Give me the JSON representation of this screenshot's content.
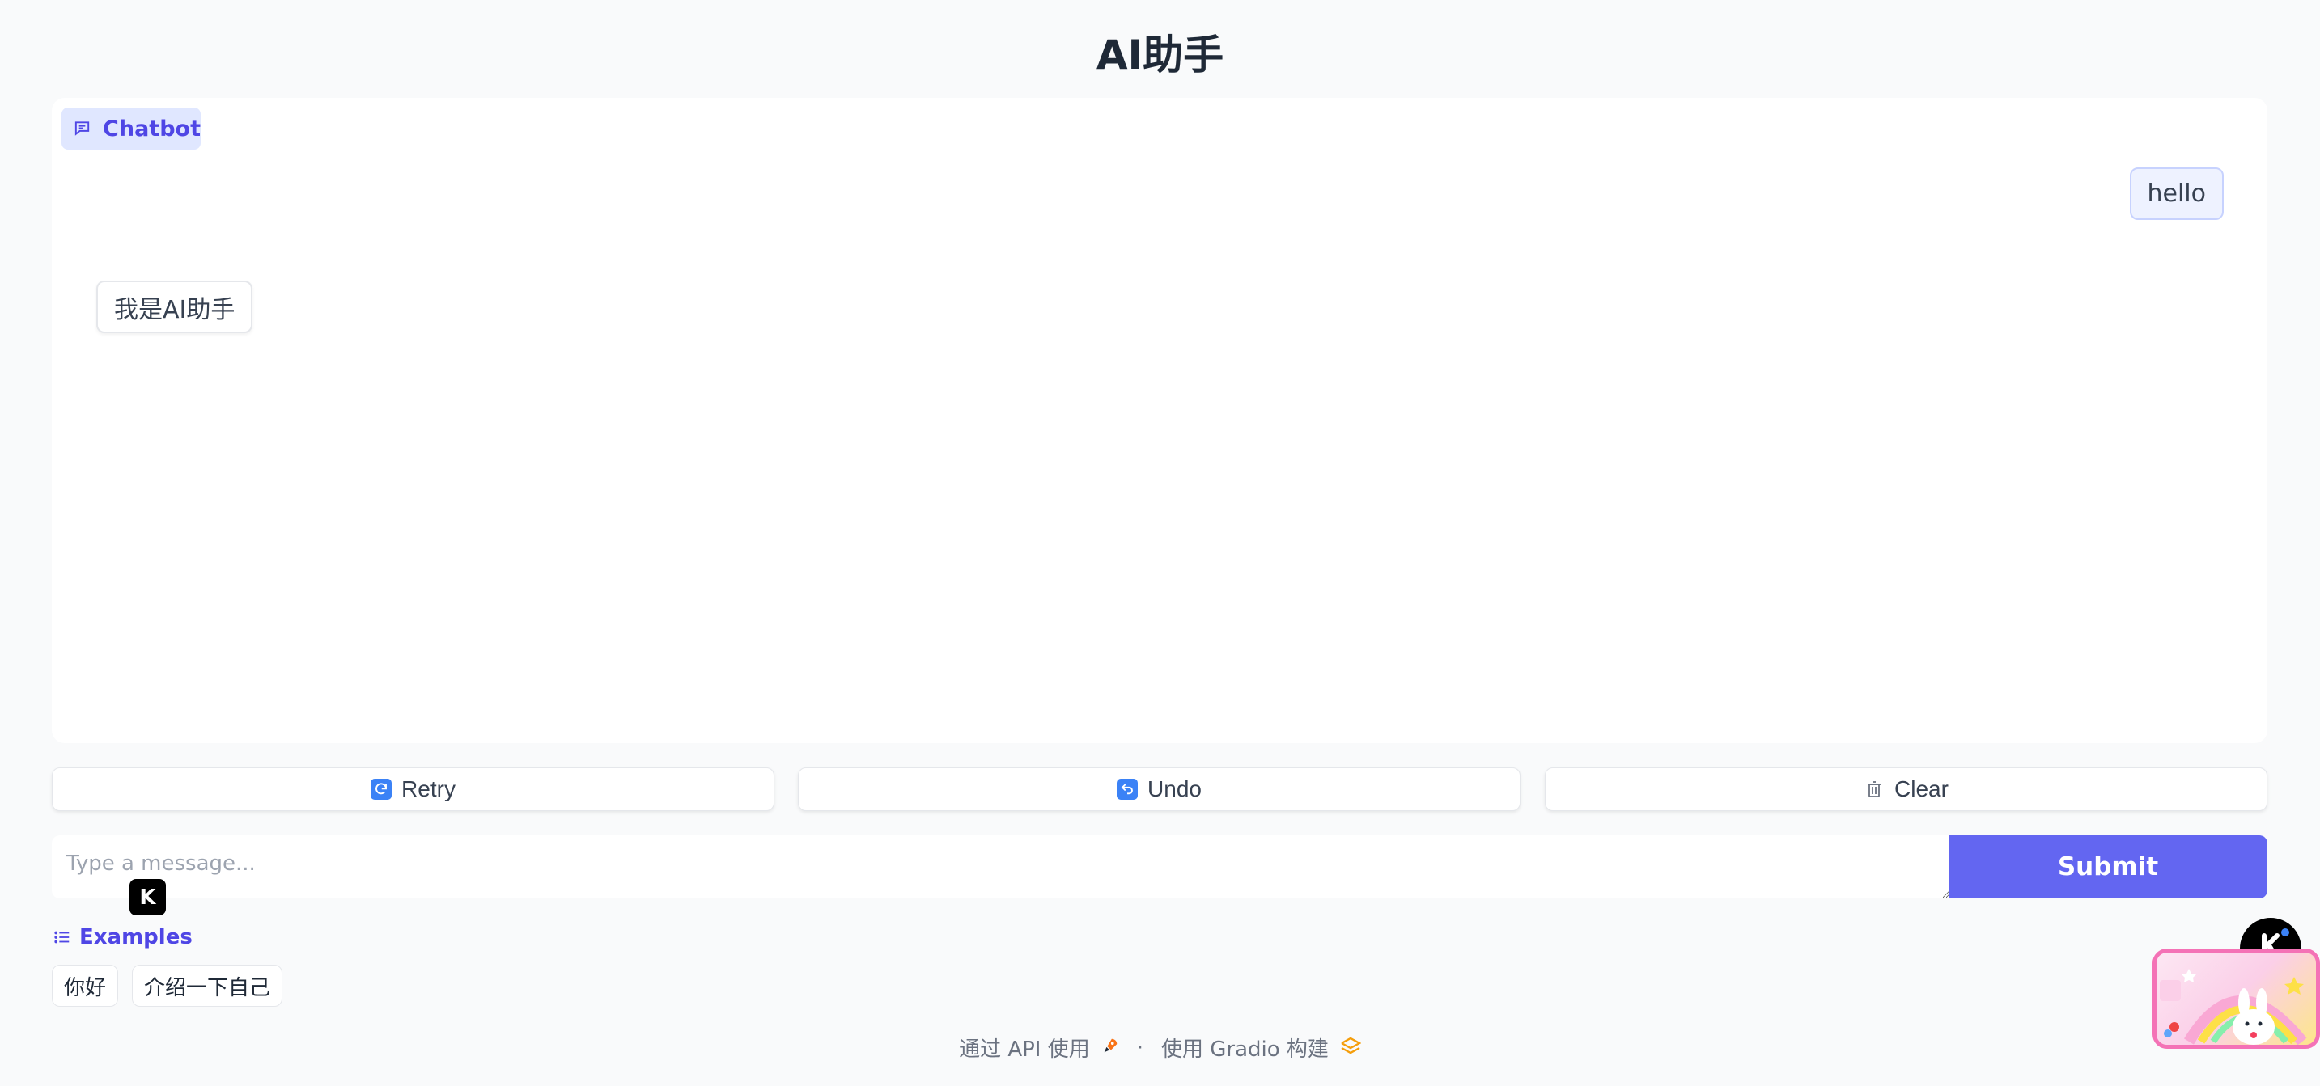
{
  "header": {
    "title": "AI助手"
  },
  "chatbot": {
    "label": "Chatbot",
    "messages": [
      {
        "role": "user",
        "text": "hello"
      },
      {
        "role": "assistant",
        "text": "我是AI助手"
      }
    ]
  },
  "actions": {
    "retry_label": "Retry",
    "undo_label": "Undo",
    "clear_label": "Clear"
  },
  "composer": {
    "placeholder": "Type a message...",
    "submit_label": "Submit"
  },
  "badge": {
    "letter": "K"
  },
  "examples": {
    "label": "Examples",
    "items": [
      "你好",
      "介绍一下自己"
    ]
  },
  "footer": {
    "api_text": "通过 API 使用",
    "separator": "·",
    "built_text": "使用 Gradio 构建"
  },
  "colors": {
    "accent": "#6366f1",
    "accent_text": "#4f46e5",
    "background": "#f9fafb"
  }
}
